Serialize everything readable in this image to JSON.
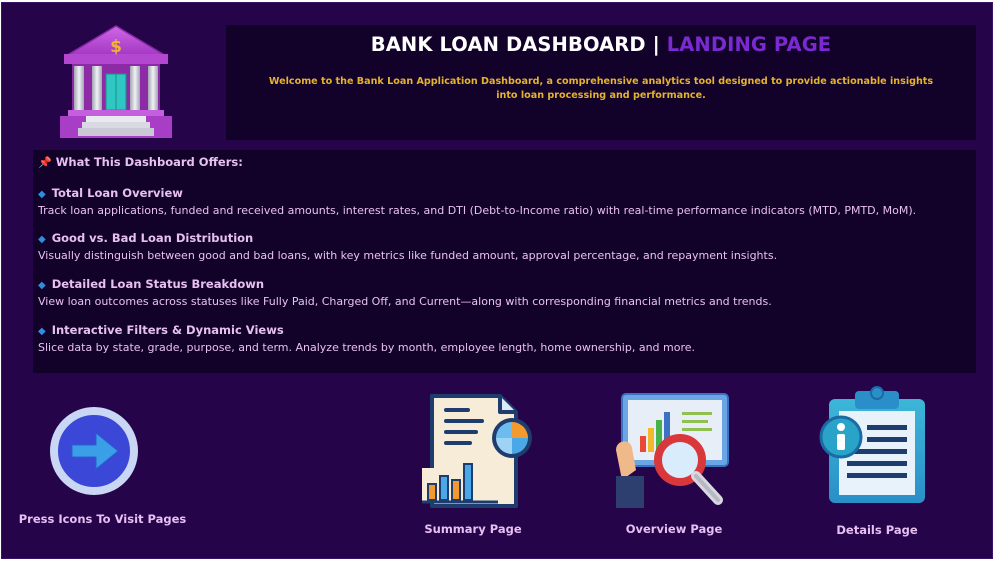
{
  "header": {
    "title_main": "BANK LOAN DASHBOARD |",
    "title_accent": "LANDING PAGE",
    "welcome": "Welcome to the Bank Loan Application Dashboard, a comprehensive analytics tool designed to provide actionable insights into loan processing and performance."
  },
  "offers": {
    "heading": "What This Dashboard Offers:",
    "heading_icon": "pushpin-icon",
    "features": [
      {
        "title": "Total Loan Overview",
        "desc": "Track loan applications, funded and received amounts, interest rates, and DTI (Debt-to-Income ratio) with real-time performance indicators (MTD, PMTD, MoM)."
      },
      {
        "title": "Good vs. Bad Loan Distribution",
        "desc": "Visually distinguish between good and bad loans, with key metrics like funded amount, approval percentage, and repayment insights."
      },
      {
        "title": "Detailed Loan Status Breakdown",
        "desc": "View loan outcomes across statuses like Fully Paid, Charged Off, and Current—along with corresponding financial metrics and trends."
      },
      {
        "title": "Interactive Filters & Dynamic Views",
        "desc": "Slice data by state, grade, purpose, and term. Analyze trends by month, employee length, home ownership, and more."
      }
    ]
  },
  "nav": {
    "press_label": "Press Icons To Visit Pages",
    "pages": [
      {
        "label": "Summary Page",
        "icon": "summary-report-icon"
      },
      {
        "label": "Overview Page",
        "icon": "overview-analytics-icon"
      },
      {
        "label": "Details Page",
        "icon": "details-clipboard-icon"
      }
    ]
  },
  "colors": {
    "background": "#260449",
    "panel": "#12022a",
    "text": "#e7c0f2",
    "accent_purple": "#7a2ad0",
    "welcome_gold": "#e6b32d"
  }
}
